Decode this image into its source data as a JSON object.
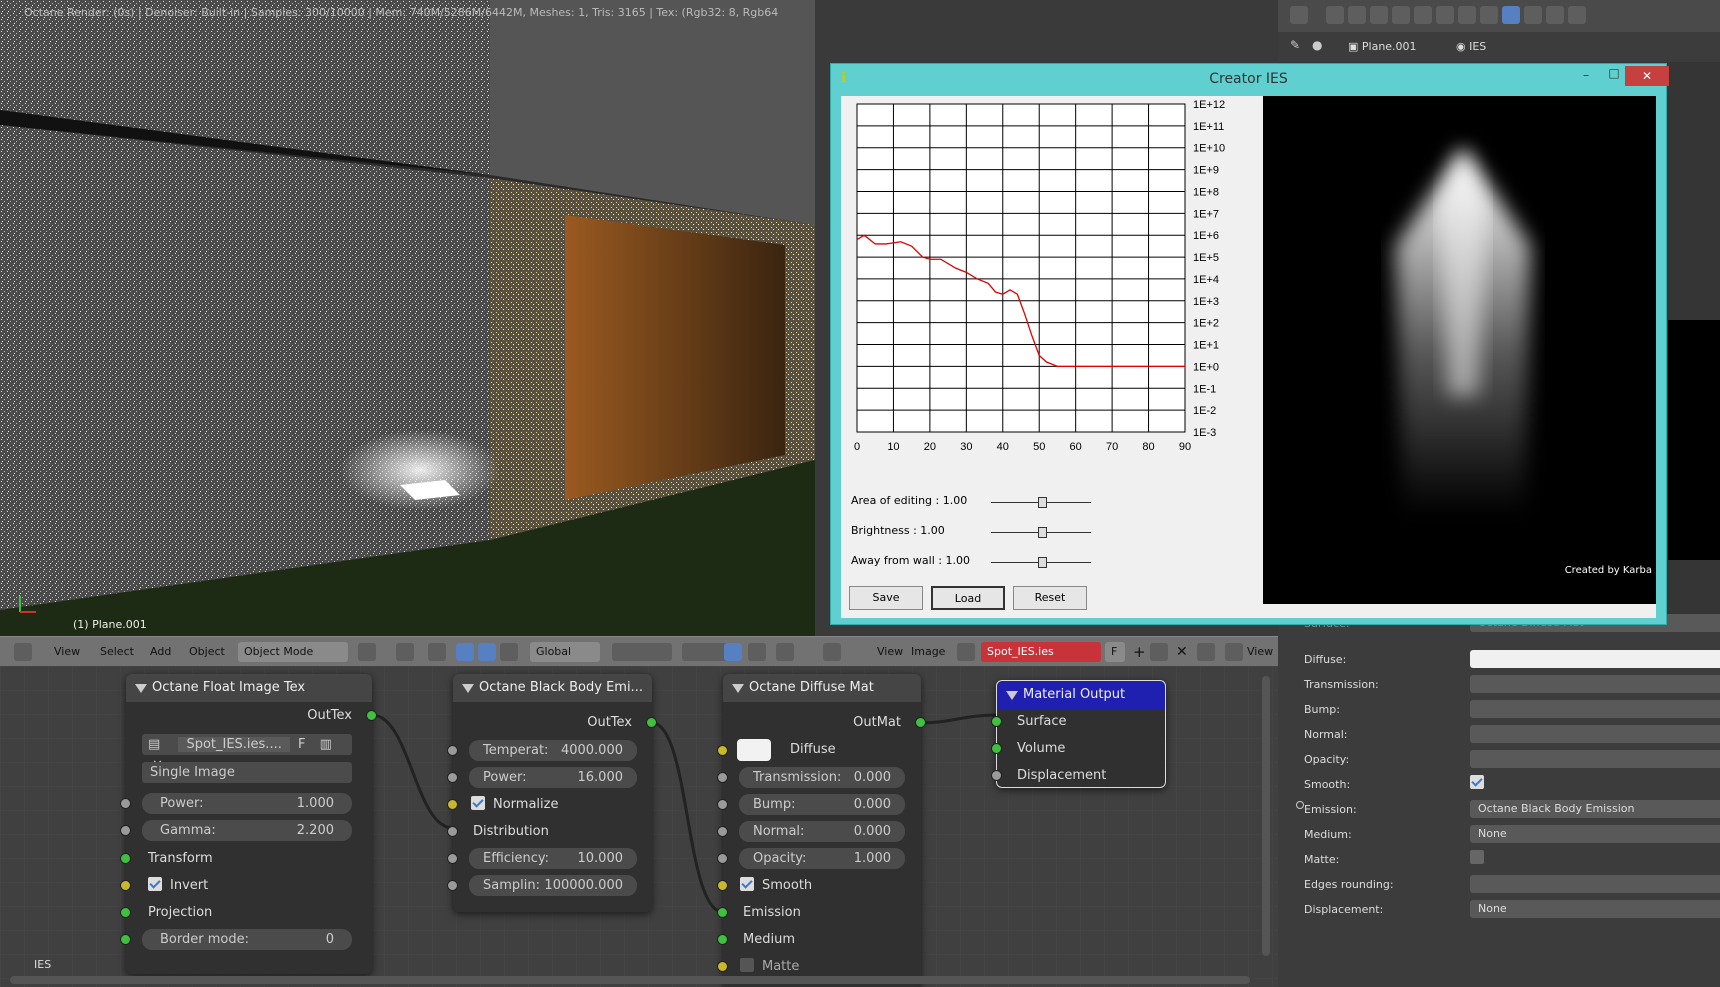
{
  "viewport": {
    "status": "Octane Render: (0s) | Denoiser: Built-in | Samples: 300/10000 | Mem: 740M/5286M/6442M, Meshes: 1, Tris: 3165 | Tex: (Rgb32: 8, Rgb64",
    "object_label": "(1) Plane.001",
    "menu": [
      "View",
      "Select",
      "Add",
      "Object"
    ],
    "mode": "Object Mode",
    "orientation": "Global"
  },
  "image_editor": {
    "menu": [
      "View",
      "Image"
    ],
    "image_name": "Spot_IES.ies",
    "f_label": "F",
    "view_label": "View"
  },
  "props": {
    "breadcrumb": [
      "Plane.001",
      "IES"
    ],
    "surface_label": "Surface:",
    "surface_value": "Octane Diffuse Mat",
    "rows": [
      {
        "label": "Diffuse:",
        "value": ""
      },
      {
        "label": "Transmission:",
        "value": ""
      },
      {
        "label": "Bump:",
        "value": ""
      },
      {
        "label": "Normal:",
        "value": ""
      },
      {
        "label": "Opacity:",
        "value": ""
      },
      {
        "label": "Smooth:",
        "value": ""
      },
      {
        "label": "Emission:",
        "value": "Octane Black Body Emission"
      },
      {
        "label": "Medium:",
        "value": "None"
      },
      {
        "label": "Matte:",
        "value": ""
      },
      {
        "label": "Edges rounding:",
        "value": ""
      },
      {
        "label": "Displacement:",
        "value": "None"
      }
    ]
  },
  "ies_window": {
    "title": "Creator IES",
    "y_ticks": [
      "1E+12",
      "1E+11",
      "1E+10",
      "1E+9",
      "1E+8",
      "1E+7",
      "1E+6",
      "1E+5",
      "1E+4",
      "1E+3",
      "1E+2",
      "1E+1",
      "1E+0",
      "1E-1",
      "1E-2",
      "1E-3"
    ],
    "x_ticks": [
      "0",
      "10",
      "20",
      "30",
      "40",
      "50",
      "60",
      "70",
      "80",
      "90"
    ],
    "sliders": [
      {
        "label": "Area of editing :  1.00",
        "value": 0.5
      },
      {
        "label": "Brightness :  1.00",
        "value": 0.5
      },
      {
        "label": "Away from wall :  1.00",
        "value": 0.5
      }
    ],
    "buttons": [
      "Save",
      "Load",
      "Reset"
    ],
    "credit": "Created by Karba"
  },
  "chart_data": {
    "type": "line",
    "x": [
      0,
      2,
      5,
      8,
      12,
      15,
      18,
      20,
      23,
      27,
      30,
      33,
      36,
      38,
      40,
      42,
      44,
      46,
      48,
      50,
      52,
      55,
      60,
      70,
      80,
      90
    ],
    "series": [
      {
        "values": [
          5.8,
          6.0,
          5.6,
          5.6,
          5.7,
          5.5,
          5.0,
          4.9,
          4.9,
          4.5,
          4.3,
          4.0,
          3.8,
          3.4,
          3.3,
          3.5,
          3.3,
          2.4,
          1.4,
          0.5,
          0.2,
          0.0,
          0.0,
          0.0,
          0.0,
          0.0
        ]
      }
    ],
    "xlim": [
      0,
      90
    ],
    "ylim": [
      -3,
      12
    ],
    "ylabel": "",
    "xlabel": "",
    "title": "",
    "grid": true,
    "line_color": "#e00000",
    "log_scale": true
  },
  "nodes": {
    "float_tex": {
      "title": "Octane Float Image Tex",
      "out": "OutTex",
      "file": "Spot_IES.ies....",
      "f": "F",
      "source": "Single Image",
      "power_label": "Power:",
      "power": "1.000",
      "gamma_label": "Gamma:",
      "gamma": "2.200",
      "transform": "Transform",
      "invert": "Invert",
      "projection": "Projection",
      "border_label": "Border mode:",
      "border": "0"
    },
    "blackbody": {
      "title": "Octane Black Body Emi...",
      "out": "OutTex",
      "temp_label": "Temperat:",
      "temp": "4000.000",
      "power_label": "Power:",
      "power": "16.000",
      "normalize": "Normalize",
      "distribution": "Distribution",
      "eff_label": "Efficiency:",
      "eff": "10.000",
      "samp_label": "Samplin:",
      "samp": "100000.000"
    },
    "diffuse": {
      "title": "Octane Diffuse Mat",
      "out": "OutMat",
      "diffuse": "Diffuse",
      "trans_label": "Transmission:",
      "trans": "0.000",
      "bump_label": "Bump:",
      "bump": "0.000",
      "normal_label": "Normal:",
      "normal": "0.000",
      "opacity_label": "Opacity:",
      "opacity": "1.000",
      "smooth": "Smooth",
      "emission": "Emission",
      "medium": "Medium",
      "matte": "Matte"
    },
    "output": {
      "title": "Material Output",
      "surface": "Surface",
      "volume": "Volume",
      "displacement": "Displacement"
    }
  },
  "node_editor_label": "IES"
}
